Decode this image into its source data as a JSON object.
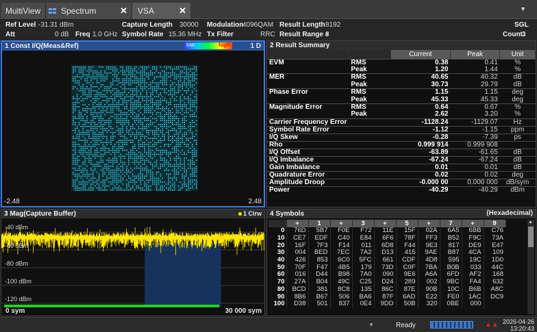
{
  "tabs": [
    {
      "label": "MultiView"
    },
    {
      "label": "Spectrum"
    },
    {
      "label": "VSA"
    }
  ],
  "header": {
    "ref_level_label": "Ref Level",
    "ref_level_value": "-31.31 dBm",
    "att_label": "Att",
    "att_value": "0 dB",
    "freq_label": "Freq",
    "freq_value": "1.0 GHz",
    "capture_length_label": "Capture Length",
    "capture_length_value": "30000",
    "symbol_rate_label": "Symbol Rate",
    "symbol_rate_value": "15.36 MHz",
    "modulation_label": "Modulation",
    "modulation_value": "4096QAM",
    "tx_filter_label": "Tx Filter",
    "tx_filter_value": "RRC",
    "result_length_label": "Result Length",
    "result_length_value": "8192",
    "result_range_label": "Result Range #",
    "result_range_value": "3",
    "sgl": "SGL",
    "count_label": "Count",
    "count_value": "3"
  },
  "panel1": {
    "title": "1 Const I/Q(Meas&Ref)",
    "legend_low": "low",
    "legend_high": "high",
    "trace": "1 D",
    "x_min": "-2.48",
    "x_max": "2.48"
  },
  "panel2": {
    "title": "2 Result Summary",
    "columns": [
      "",
      "",
      "Current",
      "Peak",
      "Unit"
    ],
    "rows": [
      {
        "name": "EVM",
        "sub": "RMS",
        "current": "0.38",
        "peak": "0.41",
        "unit": "%"
      },
      {
        "name": "",
        "sub": "Peak",
        "current": "1.20",
        "peak": "1.44",
        "unit": "%"
      },
      {
        "name": "MER",
        "sub": "RMS",
        "current": "40.65",
        "peak": "40.32",
        "unit": "dB"
      },
      {
        "name": "",
        "sub": "Peak",
        "current": "30.73",
        "peak": "29.79",
        "unit": "dB"
      },
      {
        "name": "Phase Error",
        "sub": "RMS",
        "current": "1.15",
        "peak": "1.15",
        "unit": "deg"
      },
      {
        "name": "",
        "sub": "Peak",
        "current": "45.33",
        "peak": "45.33",
        "unit": "deg"
      },
      {
        "name": "Magnitude Error",
        "sub": "RMS",
        "current": "0.64",
        "peak": "0.67",
        "unit": "%"
      },
      {
        "name": "",
        "sub": "Peak",
        "current": "2.62",
        "peak": "3.20",
        "unit": "%"
      },
      {
        "name": "Carrier Frequency Error",
        "sub": "",
        "current": "-1128.24",
        "peak": "-1129.07",
        "unit": "Hz"
      },
      {
        "name": "Symbol Rate Error",
        "sub": "",
        "current": "-1.12",
        "peak": "-1.15",
        "unit": "ppm"
      },
      {
        "name": "I/Q Skew",
        "sub": "",
        "current": "-0.28",
        "peak": "-7.39",
        "unit": "ps"
      },
      {
        "name": "Rho",
        "sub": "",
        "current": "0.999 914",
        "peak": "0.999 908",
        "unit": ""
      },
      {
        "name": "I/Q Offset",
        "sub": "",
        "current": "-63.89",
        "peak": "-61.65",
        "unit": "dB"
      },
      {
        "name": "I/Q Imbalance",
        "sub": "",
        "current": "-67.24",
        "peak": "-67.24",
        "unit": "dB"
      },
      {
        "name": "Gain Imbalance",
        "sub": "",
        "current": "0.01",
        "peak": "0.01",
        "unit": "dB"
      },
      {
        "name": "Quadrature Error",
        "sub": "",
        "current": "0.02",
        "peak": "0.02",
        "unit": "deg"
      },
      {
        "name": "Amplitude Droop",
        "sub": "",
        "current": "-0.000 00",
        "peak": "0.000 000",
        "unit": "dB/sym"
      },
      {
        "name": "Power",
        "sub": "",
        "current": "-40.29",
        "peak": "-40.29",
        "unit": "dBm"
      }
    ]
  },
  "panel3": {
    "title": "3 Mag(Capture Buffer)",
    "trace": "1 Clrw",
    "y_labels": [
      "-40 dBm",
      "-60 dBm",
      "-80 dBm",
      "-100 dBm",
      "-120 dBm"
    ],
    "x_min": "0 sym",
    "x_max": "30 000 sym",
    "result_range_fraction": [
      0.545,
      0.835
    ]
  },
  "panel4": {
    "title": "4 Symbols",
    "format": "(Hexadecimal)",
    "columns": [
      "",
      "+",
      "1",
      "+",
      "3",
      "+",
      "5",
      "+",
      "7",
      "+",
      "9"
    ],
    "rows": [
      {
        "idx": "0",
        "vals": [
          "76D",
          "5B7",
          "F0E",
          "F72",
          "11E",
          "15F",
          "02A",
          "6A5",
          "6BB",
          "C76"
        ]
      },
      {
        "idx": "10",
        "vals": [
          "CE7",
          "EDF",
          "C40",
          "E84",
          "6F6",
          "78F",
          "FF3",
          "B52",
          "F9C",
          "73A"
        ]
      },
      {
        "idx": "20",
        "vals": [
          "16F",
          "7F3",
          "F14",
          "011",
          "6D8",
          "F44",
          "9E3",
          "817",
          "DE9",
          "E47"
        ]
      },
      {
        "idx": "30",
        "vals": [
          "004",
          "BED",
          "7EC",
          "7A2",
          "D13",
          "415",
          "9AE",
          "B87",
          "4CA",
          "109"
        ]
      },
      {
        "idx": "40",
        "vals": [
          "426",
          "853",
          "6C0",
          "5FC",
          "661",
          "CDF",
          "4D8",
          "595",
          "19C",
          "1D0"
        ]
      },
      {
        "idx": "50",
        "vals": [
          "70F",
          "F47",
          "4B5",
          "179",
          "73D",
          "C0F",
          "7BA",
          "B0B",
          "033",
          "44C"
        ]
      },
      {
        "idx": "60",
        "vals": [
          "016",
          "D44",
          "B98",
          "7A0",
          "090",
          "9E6",
          "A6A",
          "6FD",
          "AF2",
          "168"
        ]
      },
      {
        "idx": "70",
        "vals": [
          "27A",
          "B04",
          "49C",
          "C25",
          "D24",
          "289",
          "002",
          "9BC",
          "FA4",
          "632"
        ]
      },
      {
        "idx": "80",
        "vals": [
          "BCD",
          "381",
          "8C8",
          "135",
          "86C",
          "87E",
          "90B",
          "10C",
          "B6B",
          "A8C"
        ]
      },
      {
        "idx": "90",
        "vals": [
          "8B6",
          "B67",
          "506",
          "BA6",
          "87F",
          "6AD",
          "E22",
          "FE0",
          "1AC",
          "DC9"
        ]
      },
      {
        "idx": "100",
        "vals": [
          "D38",
          "501",
          "837",
          "0E4",
          "9DD",
          "50B",
          "320",
          "0BE",
          "000",
          ""
        ]
      }
    ]
  },
  "status": {
    "ready": "Ready",
    "date": "2026-04-26",
    "time": "13:20:43"
  },
  "colors": {
    "accent": "#3d7be6",
    "constellation": "#38d8f0",
    "trace_yellow": "#ffe600",
    "range_green": "#1fd21f"
  }
}
